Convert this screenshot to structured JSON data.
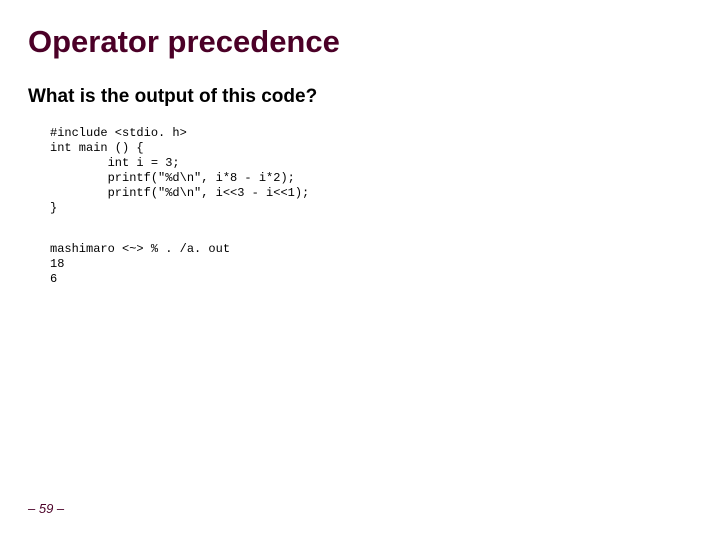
{
  "title": "Operator precedence",
  "question": "What is the output of this code?",
  "code": "#include <stdio. h>\nint main () {\n        int i = 3;\n        printf(\"%d\\n\", i*8 - i*2);\n        printf(\"%d\\n\", i<<3 - i<<1);\n}",
  "output": "mashimaro <~> % . /a. out\n18\n6",
  "footer": "– 59 –"
}
